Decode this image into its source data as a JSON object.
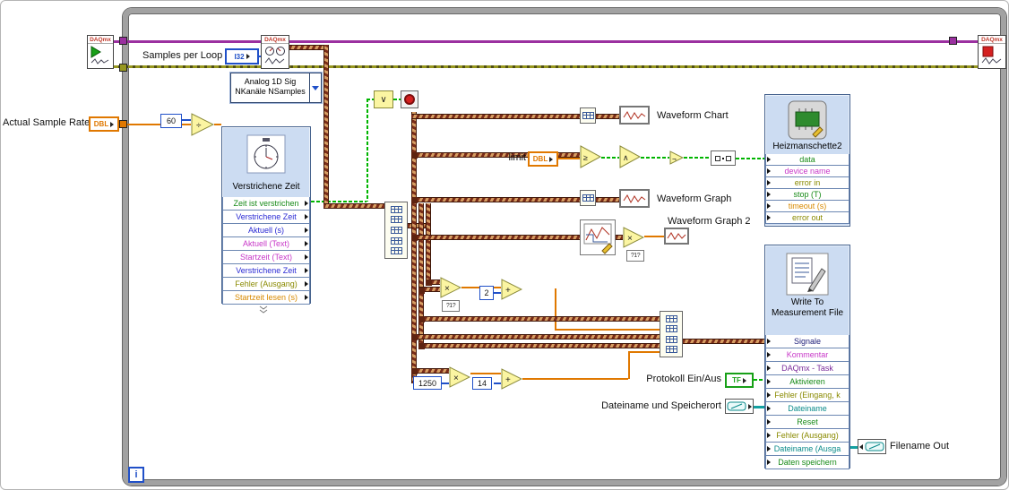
{
  "daqmx": {
    "brand": "DAQmx"
  },
  "loop": {
    "iteration": "i"
  },
  "controls": {
    "samples_per_loop": {
      "label": "Samples per Loop",
      "type": "I32"
    },
    "poly_selector": {
      "line1": "Analog 1D Sig",
      "line2": "NKanäle NSamples"
    },
    "actual_sample_rate": {
      "label": "Actual Sample Rate",
      "type": "DBL"
    },
    "limit": {
      "label": "limit",
      "type": "DBL"
    },
    "protokoll": {
      "label": "Protokoll Ein/Aus",
      "type": "TF"
    },
    "dateiname": {
      "label": "Dateiname und Speicherort"
    },
    "filename_out": {
      "label": "Filename Out"
    }
  },
  "constants": {
    "c60": "60",
    "c2": "2",
    "c1250": "1250",
    "c14": "14"
  },
  "indicators": {
    "waveform_chart": "Waveform Chart",
    "waveform_graph": "Waveform Graph",
    "waveform_graph2": "Waveform Graph 2"
  },
  "nodes": {
    "divide": "÷",
    "multiply": "×",
    "add": "+",
    "greater_equal": "≥",
    "and": "∧",
    "not": "¬",
    "or": "∨",
    "convert": "?1?"
  },
  "elapsed_time": {
    "title": "Verstrichene Zeit",
    "rows": [
      {
        "label": "Zeit ist verstrichen",
        "color": "#178a17"
      },
      {
        "label": "Verstrichene Zeit",
        "color": "#2a2ad4"
      },
      {
        "label": "Aktuell (s)",
        "color": "#2a2ad4"
      },
      {
        "label": "Aktuell (Text)",
        "color": "#c838c8"
      },
      {
        "label": "Startzeit (Text)",
        "color": "#c838c8"
      },
      {
        "label": "Verstrichene Zeit",
        "color": "#2a2ad4"
      },
      {
        "label": "Fehler (Ausgang)",
        "color": "#8a8a00"
      },
      {
        "label": "Startzeit lesen (s)",
        "color": "#d88a00"
      }
    ]
  },
  "heizmanschette": {
    "title": "Heizmanschette2",
    "rows": [
      {
        "label": "data",
        "color": "#178a17"
      },
      {
        "label": "device name",
        "color": "#c838c8"
      },
      {
        "label": "error in",
        "color": "#8a8a00"
      },
      {
        "label": "stop (T)",
        "color": "#178a17"
      },
      {
        "label": "timeout (s)",
        "color": "#d88a00"
      },
      {
        "label": "error out",
        "color": "#8a8a00"
      }
    ]
  },
  "write_file": {
    "title_line1": "Write To",
    "title_line2": "Measurement File",
    "rows": [
      {
        "label": "Signale",
        "color": "#20207a"
      },
      {
        "label": "Kommentar",
        "color": "#c838c8"
      },
      {
        "label": "DAQmx - Task",
        "color": "#7a2a9a"
      },
      {
        "label": "Aktivieren",
        "color": "#178a17"
      },
      {
        "label": "Fehler (Eingang, k",
        "color": "#8a8a00"
      },
      {
        "label": "Dateiname",
        "color": "#0a8a8a"
      },
      {
        "label": "Reset",
        "color": "#178a17"
      },
      {
        "label": "Fehler (Ausgang)",
        "color": "#8a8a00"
      },
      {
        "label": "Dateiname (Ausga",
        "color": "#0a8a8a"
      },
      {
        "label": "Daten speichern",
        "color": "#178a17"
      }
    ]
  },
  "colors": {
    "task_wire": "#9b30a0",
    "error_wire": "#97971f",
    "numeric_wire": "#e07800",
    "boolean_wire": "#00b400",
    "integer_wire": "#2050c8",
    "path_wire": "#12a0a0",
    "dynamic_wire": "#7a2c18",
    "express_bg": "#ccdcf2",
    "loop_border": "#a2a2a2"
  }
}
